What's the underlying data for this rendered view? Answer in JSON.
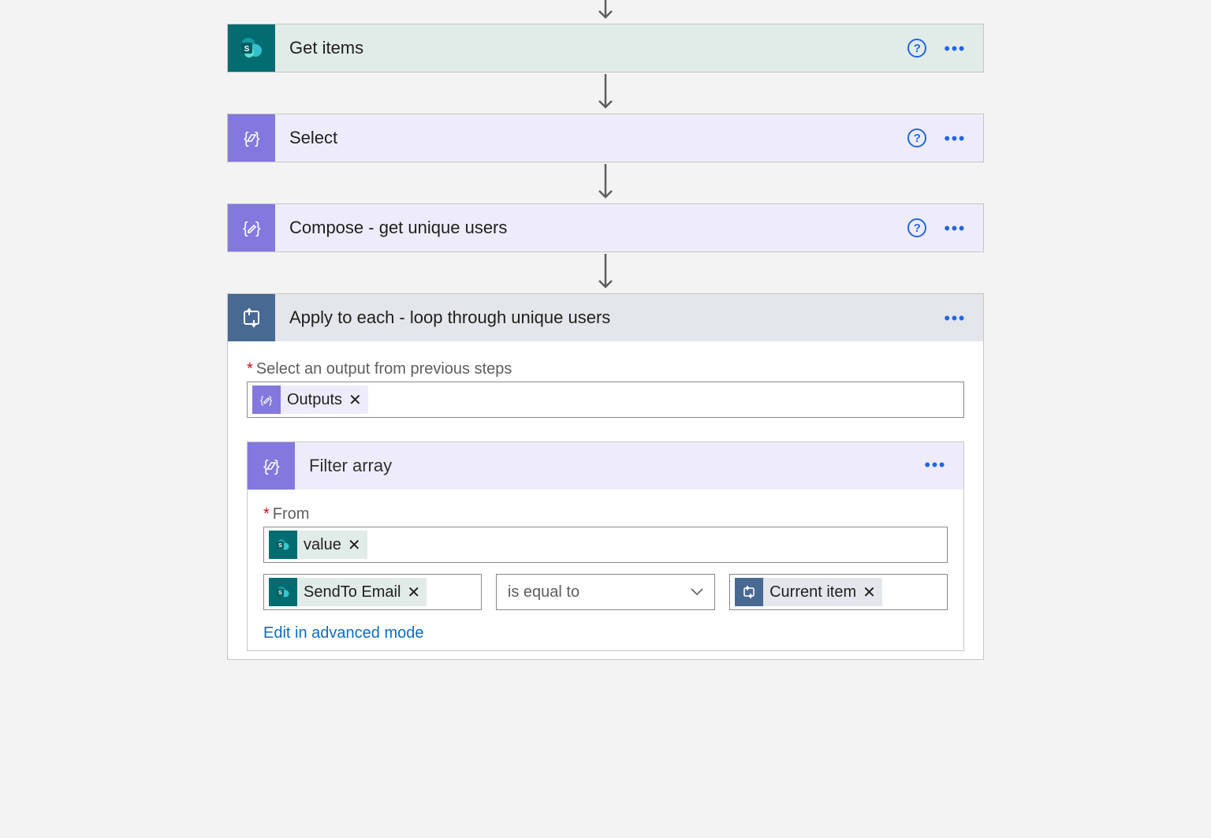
{
  "steps": {
    "get_items": {
      "title": "Get items"
    },
    "select": {
      "title": "Select"
    },
    "compose": {
      "title": "Compose - get unique users"
    },
    "apply_each": {
      "title": "Apply to each - loop through unique users"
    }
  },
  "apply_each_body": {
    "output_label": "Select an output from previous steps",
    "output_token": "Outputs"
  },
  "filter": {
    "title": "Filter array",
    "from_label": "From",
    "from_token": "value",
    "left_token": "SendTo Email",
    "operator": "is equal to",
    "right_token": "Current item",
    "advanced_link": "Edit in advanced mode"
  },
  "symbols": {
    "required": "*",
    "close": "✕",
    "ellipsis": "•••",
    "help": "?"
  }
}
